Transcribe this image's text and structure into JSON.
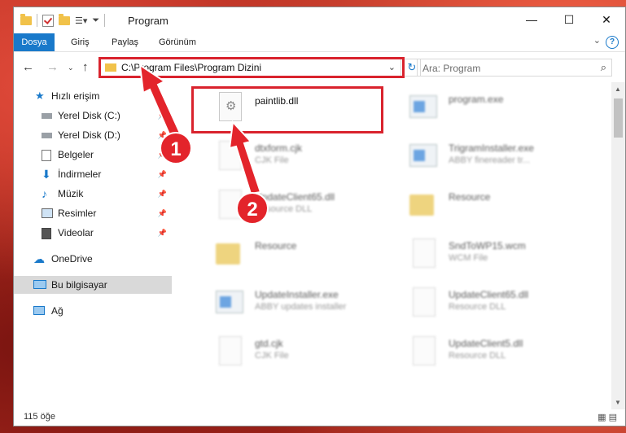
{
  "window": {
    "title": "Program",
    "controls": [
      "—",
      "☐",
      "✕"
    ]
  },
  "ribbon": {
    "tabs": [
      "Dosya",
      "Giriş",
      "Paylaş",
      "Görünüm"
    ],
    "help": "?"
  },
  "address": {
    "path": "C:\\Program Files\\Program Dizini",
    "search_placeholder": "Ara: Program"
  },
  "sidebar": {
    "items": [
      {
        "label": "Hızlı erişim",
        "icon": "star-icon"
      },
      {
        "label": "Yerel Disk (C:)",
        "icon": "drive-icon"
      },
      {
        "label": "Yerel Disk (D:)",
        "icon": "drive-icon"
      },
      {
        "label": "Belgeler",
        "icon": "documents-icon"
      },
      {
        "label": "İndirmeler",
        "icon": "download-icon"
      },
      {
        "label": "Müzik",
        "icon": "music-icon"
      },
      {
        "label": "Resimler",
        "icon": "pictures-icon"
      },
      {
        "label": "Videolar",
        "icon": "videos-icon"
      },
      {
        "label": "OneDrive",
        "icon": "cloud-icon"
      },
      {
        "label": "Bu bilgisayar",
        "icon": "computer-icon"
      },
      {
        "label": "Ağ",
        "icon": "network-icon"
      }
    ]
  },
  "files": [
    {
      "name": "paintlib.dll",
      "type": ""
    },
    {
      "name": "program.exe",
      "type": ""
    },
    {
      "name": "dtxform.cjk",
      "type": "CJK File"
    },
    {
      "name": "TrigramInstaller.exe",
      "type": "ABBY finereader tr..."
    },
    {
      "name": "UpdateClient65.dll",
      "type": "Resource DLL"
    },
    {
      "name": "Resource",
      "type": ""
    },
    {
      "name": "Resource",
      "type": ""
    },
    {
      "name": "SndToWP15.wcm",
      "type": "WCM File"
    },
    {
      "name": "UpdateInstaller.exe",
      "type": "ABBY updates installer"
    },
    {
      "name": "UpdateClient65.dll",
      "type": "Resource DLL"
    },
    {
      "name": "gtd.cjk",
      "type": "CJK File"
    },
    {
      "name": "UpdateClient5.dll",
      "type": "Resource DLL"
    }
  ],
  "status": {
    "count": "115 öğe"
  },
  "callouts": [
    "1",
    "2"
  ],
  "colors": {
    "accent": "#1979ca",
    "highlight": "#d9232d"
  }
}
